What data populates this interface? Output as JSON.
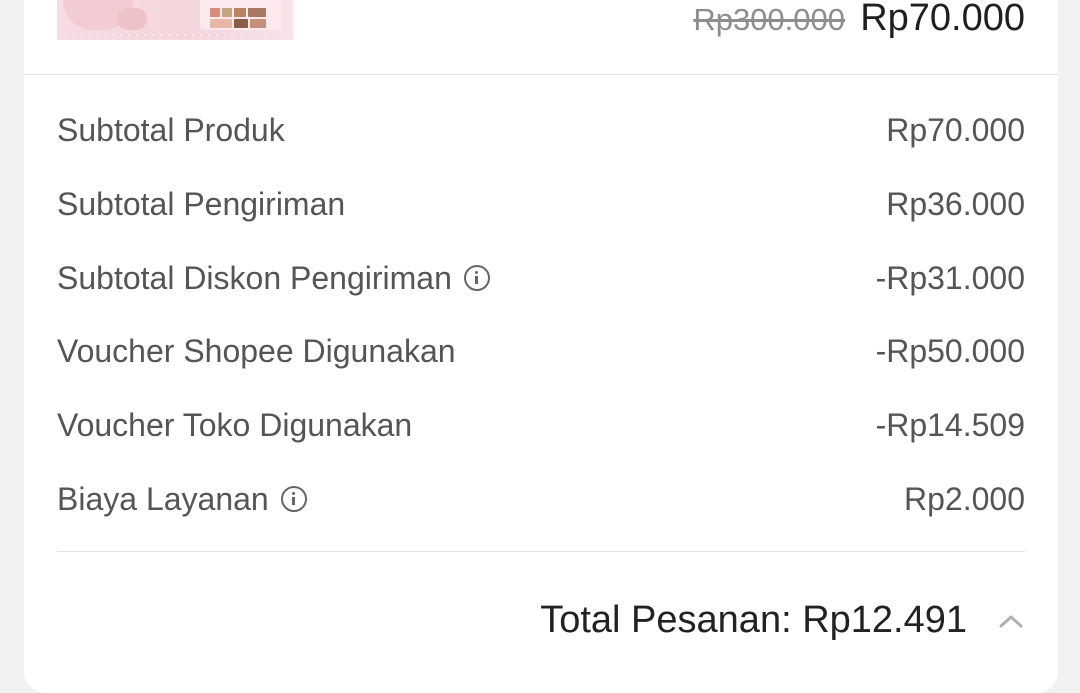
{
  "product": {
    "price_original": "Rp300.000",
    "price_now": "Rp70.000"
  },
  "summary": {
    "rows": [
      {
        "label": "Subtotal Produk",
        "value": "Rp70.000",
        "info": false
      },
      {
        "label": "Subtotal Pengiriman",
        "value": "Rp36.000",
        "info": false
      },
      {
        "label": "Subtotal Diskon Pengiriman",
        "value": "-Rp31.000",
        "info": true
      },
      {
        "label": "Voucher Shopee Digunakan",
        "value": "-Rp50.000",
        "info": false
      },
      {
        "label": "Voucher Toko Digunakan",
        "value": "-Rp14.509",
        "info": false
      },
      {
        "label": "Biaya Layanan",
        "value": "Rp2.000",
        "info": true
      }
    ],
    "total_text": "Total Pesanan: Rp12.491"
  },
  "icons": {
    "info": "info-circle-icon",
    "collapse": "chevron-up-icon"
  },
  "colors": {
    "background": "#f2f2f2",
    "card": "#ffffff",
    "text_primary": "#1f1f1f",
    "text_secondary": "#555555",
    "strikethrough": "#8e8e8e",
    "divider": "#e3e3e3"
  }
}
